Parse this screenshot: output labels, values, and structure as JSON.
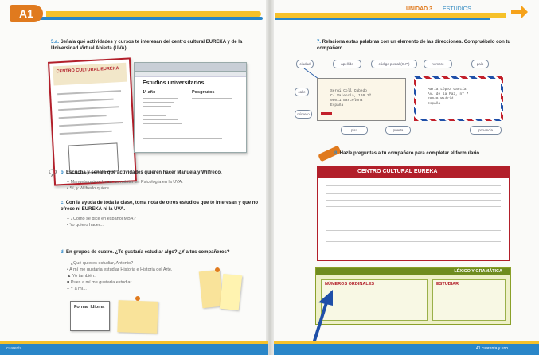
{
  "header": {
    "badge": "A1",
    "unit_title": "UNIDAD 3",
    "unit_subtitle": "ESTUDIOS"
  },
  "left_page": {
    "act5a": {
      "num": "5.a.",
      "text": "Señala qué actividades y cursos te interesan del centro cultural EUREKA y de la Universidad Virtual Abierta (UVA)."
    },
    "ticket_title": "CENTRO CULTURAL EUREKA",
    "browser_title": "Estudios universitarios",
    "browser_col1": "1º año",
    "browser_col2": "Posgrados",
    "act5b": {
      "num": "b.",
      "text": "Escucha y señala qué actividades quieren hacer Manuela y Wilfredo."
    },
    "act5b_lines": [
      "– Manuela quiere hacer un máster en Psicología en la UVA.",
      "• Sí, y Wilfredo quiere..."
    ],
    "act5c": {
      "num": "c.",
      "text": "Con la ayuda de toda la clase, toma nota de otros estudios que te interesan y que no ofrece ni EUREKA ni la UVA."
    },
    "act5c_lines": [
      "– ¿Cómo se dice en español MBA?",
      "• Yo quiero hacer..."
    ],
    "act5d": {
      "num": "d.",
      "text": "En grupos de cuatro. ¿Te gustaría estudiar algo? ¿Y a tus compañeros?"
    },
    "act5d_lines": [
      "– ¿Qué quieres estudiar, Antonio?",
      "• A mí me gustaría estudiar Historia e Historia del Arte.",
      "▲ Yo también.",
      "■ Pues a mí me gustaría estudiar...",
      "– Y a mí..."
    ],
    "note_left": "Formar Idioma",
    "footer": "cuarenta"
  },
  "right_page": {
    "act7": {
      "num": "7.",
      "text": "Relaciona estas palabras con un elemento de las direcciones. Compruébalo con tu compañero."
    },
    "tags": [
      "ciudad",
      "apellido",
      "código postal (C.P.)",
      "nombre",
      "país",
      "calle",
      "número",
      "piso",
      "puerta",
      "provincia"
    ],
    "env1": [
      "Sergi Coll Cubedo",
      "C/ Valencia, 120 1ª",
      "08011 Barcelona",
      "España"
    ],
    "env2": [
      "María López García",
      "Av. de la Paz, nº 7",
      "28040 Madrid",
      "España"
    ],
    "act8": {
      "num": "8.",
      "text": "Hazle preguntas a tu compañero para completar el formulario."
    },
    "form_title": "CENTRO CULTURAL EUREKA",
    "grammar_title": "LÉXICO Y GRAMÁTICA",
    "grammar_left": "NÚMEROS ORDINALES",
    "grammar_right": "ESTUDIAR",
    "footer": "41 cuarenta y uno"
  }
}
